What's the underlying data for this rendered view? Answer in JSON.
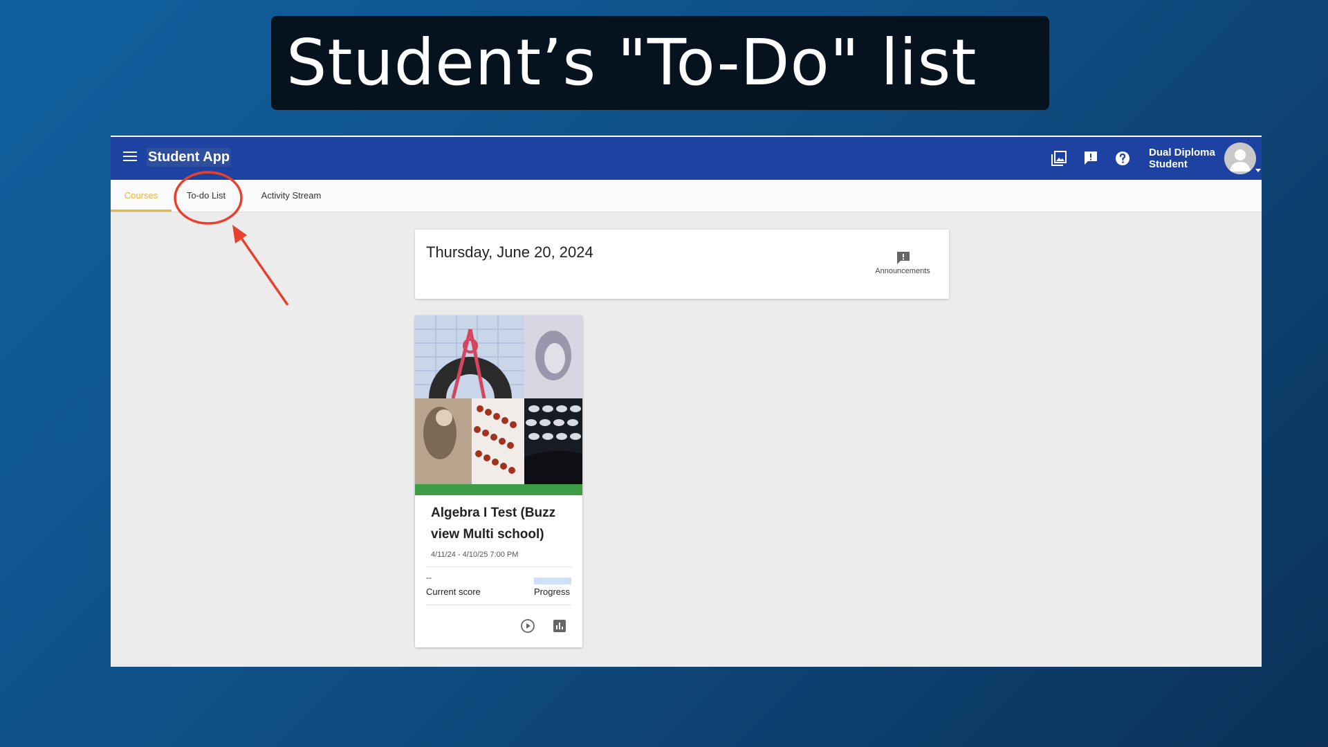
{
  "slide": {
    "title": "Student’s \"To-Do\" list"
  },
  "app": {
    "title": "Student App",
    "user": {
      "line1": "Dual Diploma",
      "line2": "Student"
    },
    "tabs": [
      {
        "label": "Courses",
        "active": true
      },
      {
        "label": "To-do List",
        "active": false
      },
      {
        "label": "Activity Stream",
        "active": false
      }
    ],
    "icons": {
      "toolbar": [
        "gallery-icon",
        "feedback-icon",
        "help-icon"
      ],
      "menu": "menu-icon"
    }
  },
  "main": {
    "date": "Thursday, June 20, 2024",
    "announcements_label": "Announcements",
    "course": {
      "title": "Algebra I Test (Buzz view Multi school)",
      "dates": "4/11/24 - 4/10/25 7:00 PM",
      "current_score": "--",
      "current_score_label": "Current score",
      "progress_label": "Progress"
    }
  },
  "colors": {
    "header": "#1e42a2",
    "active_tab": "#f0b531",
    "course_bar": "#3e9b46",
    "annotation": "#e8402c"
  }
}
